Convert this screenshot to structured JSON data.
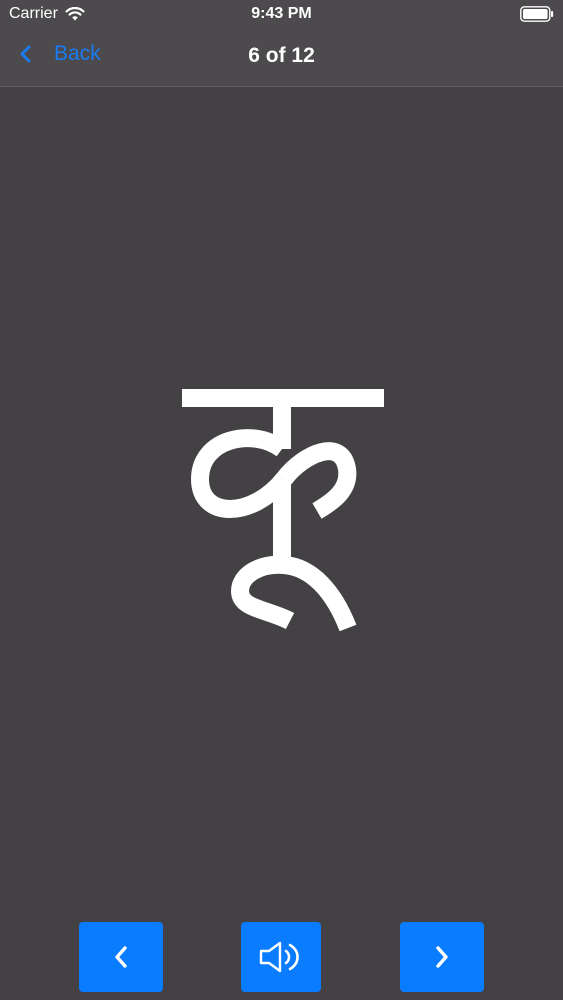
{
  "status_bar": {
    "carrier": "Carrier",
    "time": "9:43 PM"
  },
  "nav": {
    "back_label": "Back",
    "title": "6 of 12"
  },
  "card": {
    "character": "कू"
  },
  "controls": {
    "previous_icon": "chevron-left-icon",
    "speak_icon": "speaker-icon",
    "next_icon": "chevron-right-icon"
  },
  "colors": {
    "background": "#434144",
    "bar": "#4c4a4d",
    "accent": "#0a7cff",
    "back_text": "#1a7bf2"
  }
}
